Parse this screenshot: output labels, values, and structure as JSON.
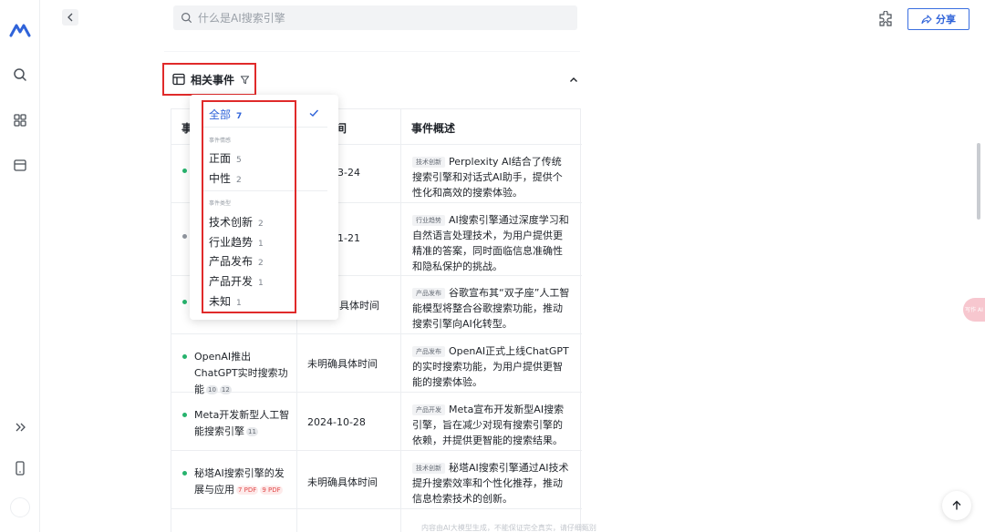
{
  "search": {
    "placeholder": "什么是AI搜索引擎"
  },
  "header": {
    "share_label": "分享"
  },
  "section": {
    "title": "相关事件"
  },
  "table": {
    "columns": [
      "事",
      "间",
      "事件概述"
    ],
    "rows": [
      {
        "dot": "green",
        "name": "",
        "refs": [],
        "time": "3-24",
        "tag": "技术创新",
        "desc": "Perplexity AI结合了传统搜索引擎和对话式AI助手，提供个性化和高效的搜索体验。"
      },
      {
        "dot": "gray",
        "name": "",
        "refs": [],
        "time": "1-21",
        "tag": "行业趋势",
        "desc": "AI搜索引擎通过深度学习和自然语言处理技术，为用户提供更精准的答案，同时面临信息准确性和隐私保护的挑战。"
      },
      {
        "dot": "green",
        "name": "",
        "refs": [],
        "time": "具体时间",
        "tag": "产品发布",
        "desc": "谷歌宣布其“双子座”人工智能模型将整合谷歌搜索功能，推动搜索引擎向AI化转型。"
      },
      {
        "dot": "green",
        "name": "OpenAI推出ChatGPT实时搜索功能",
        "refs": [
          "10",
          "12"
        ],
        "refs_type": "num",
        "time": "未明确具体时间",
        "tag": "产品发布",
        "desc": "OpenAI正式上线ChatGPT的实时搜索功能，为用户提供更智能的搜索体验。"
      },
      {
        "dot": "green",
        "name": "Meta开发新型人工智能搜索引擎",
        "refs": [
          "11"
        ],
        "refs_type": "num",
        "time": "2024-10-28",
        "tag": "产品开发",
        "desc": "Meta宣布开发新型AI搜索引擎，旨在减少对现有搜索引擎的依赖，并提供更智能的搜索结果。"
      },
      {
        "dot": "green",
        "name": "秘塔AI搜索引擎的发展与应用",
        "refs": [
          "7 PDF",
          "9 PDF"
        ],
        "refs_type": "pdf",
        "time": "未明确具体时间",
        "tag": "技术创新",
        "desc": "秘塔AI搜索引擎通过AI技术提升搜索效率和个性化推荐，推动信息检索技术的创新。"
      }
    ]
  },
  "filter": {
    "all": {
      "label": "全部",
      "count": "7"
    },
    "group_sentiment": "事件情感",
    "sentiment": [
      {
        "label": "正面",
        "count": "5"
      },
      {
        "label": "中性",
        "count": "2"
      }
    ],
    "group_type": "事件类型",
    "types": [
      {
        "label": "技术创新",
        "count": "2"
      },
      {
        "label": "行业趋势",
        "count": "1"
      },
      {
        "label": "产品发布",
        "count": "2"
      },
      {
        "label": "产品开发",
        "count": "1"
      },
      {
        "label": "未知",
        "count": "1"
      }
    ]
  },
  "floating": {
    "side_tab": "写作 AI"
  },
  "footer": {
    "note": "内容由AI大模型生成，不能保证完全真实，请仔细甄别"
  },
  "colors": {
    "accent": "#2f63d9",
    "highlight_border": "#e02a2a",
    "positive_dot": "#27b36d"
  }
}
